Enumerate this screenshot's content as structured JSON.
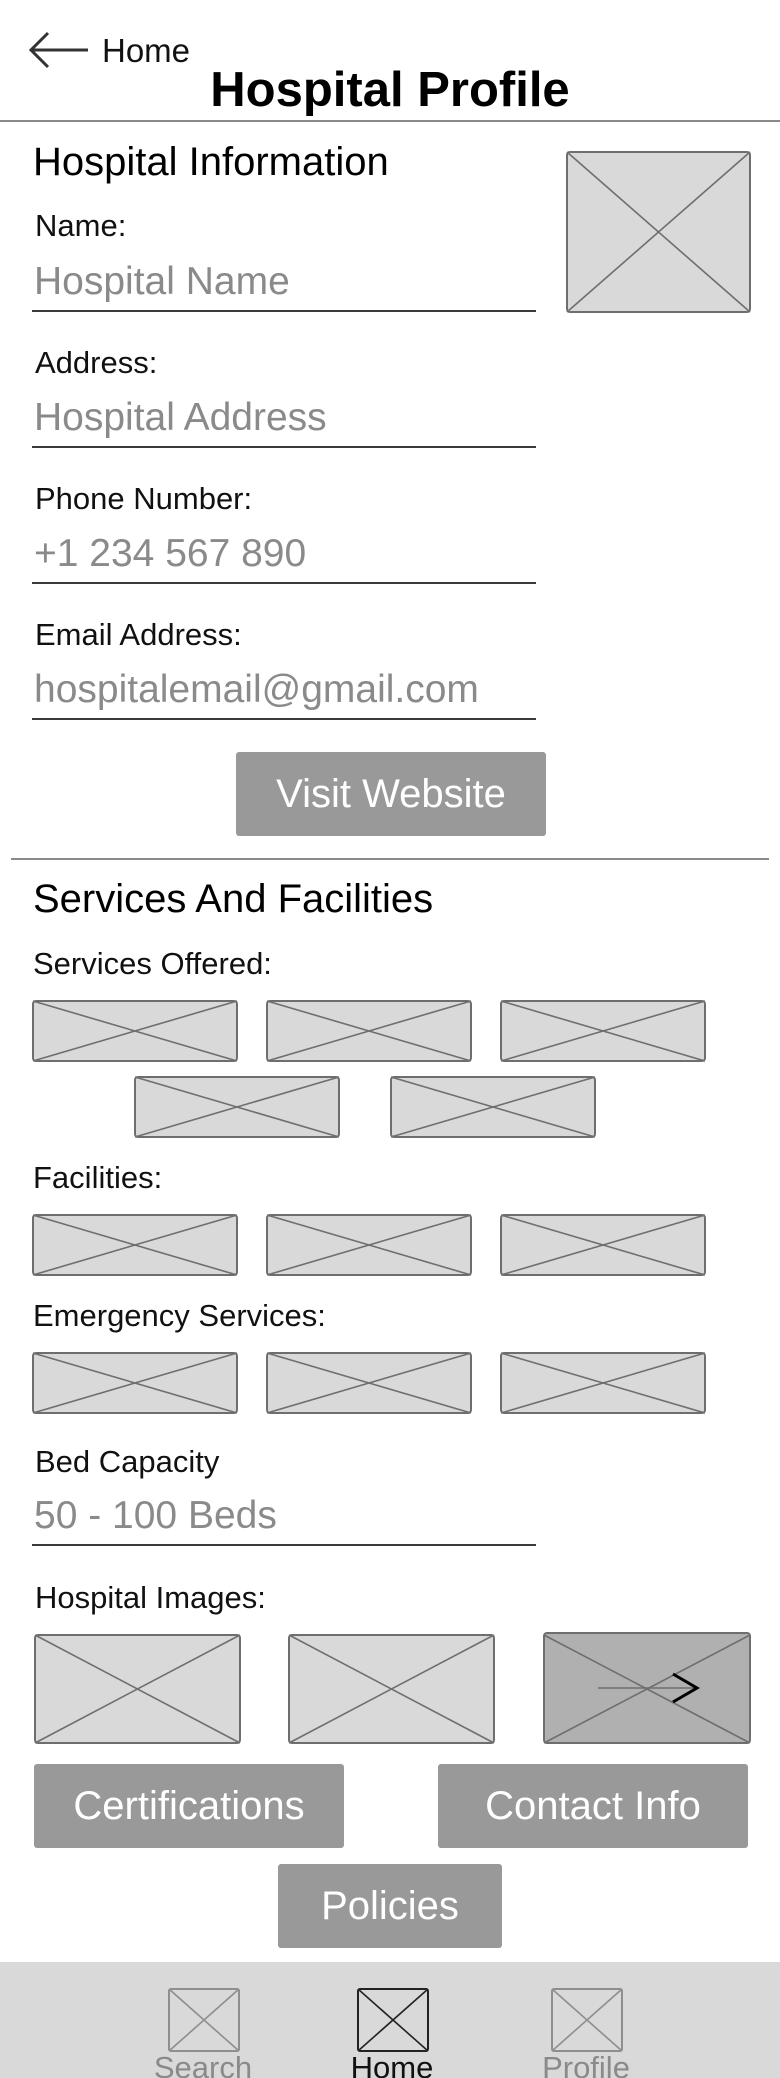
{
  "header": {
    "back_label": "Home",
    "title": "Hospital Profile"
  },
  "hospital_info": {
    "heading": "Hospital Information",
    "name_label": "Name:",
    "name_placeholder": "Hospital Name",
    "address_label": "Address:",
    "address_placeholder": "Hospital Address",
    "phone_label": "Phone Number:",
    "phone_placeholder": "+1 234 567 890",
    "email_label": "Email Address:",
    "email_placeholder": "hospitalemail@gmail.com",
    "website_button": "Visit Website"
  },
  "services": {
    "heading": "Services And Facilities",
    "services_label": "Services Offered:",
    "facilities_label": "Facilities:",
    "emergency_label": "Emergency Services:",
    "bed_label": "Bed Capacity",
    "bed_placeholder": "50 - 100 Beds",
    "images_label": "Hospital Images:"
  },
  "actions": {
    "certifications": "Certifications",
    "contact": "Contact Info",
    "policies": "Policies"
  },
  "nav": {
    "items": [
      {
        "label": "Search",
        "active": false
      },
      {
        "label": "Home",
        "active": true
      },
      {
        "label": "Profile",
        "active": false
      }
    ]
  },
  "colors": {
    "button": "#999999",
    "placeholder_fill": "#d9d9d9",
    "navbar": "#d9d9d9"
  }
}
